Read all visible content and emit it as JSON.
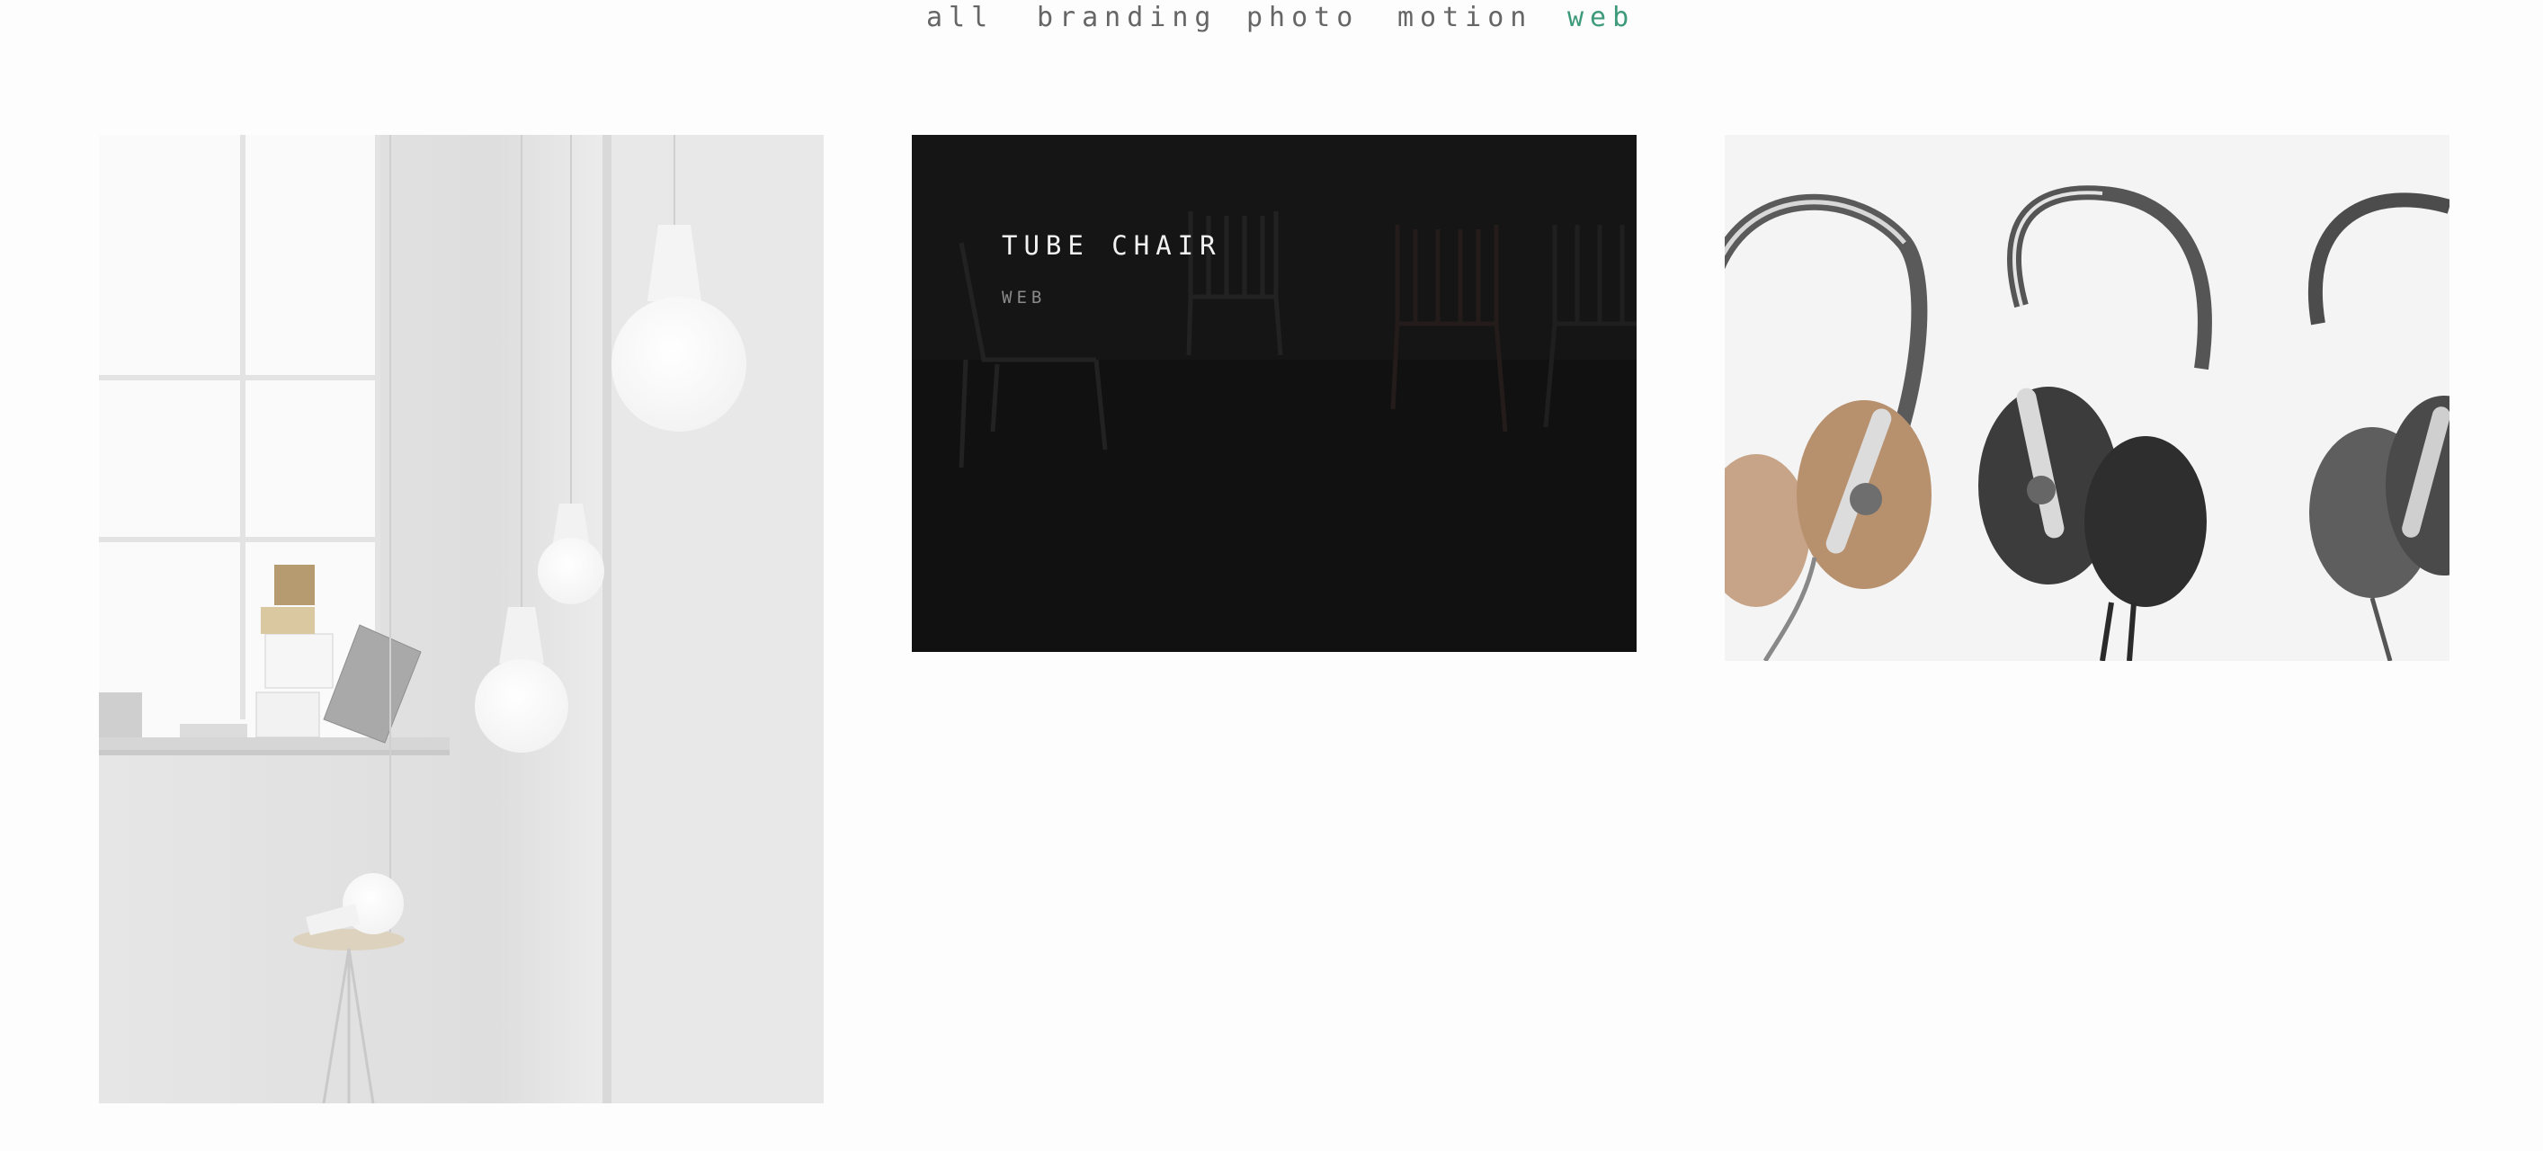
{
  "filters": [
    {
      "label": "all",
      "active": false
    },
    {
      "label": "branding",
      "active": false
    },
    {
      "label": "photo",
      "active": false
    },
    {
      "label": "motion",
      "active": false
    },
    {
      "label": "web",
      "active": true
    }
  ],
  "colors": {
    "accent": "#3d9a7a",
    "nav_text": "#666666",
    "overlay_bg": "#141414",
    "page_bg": "#fdfdfd"
  },
  "portfolio": {
    "items": [
      {
        "image": "pendant-lamps-photo"
      },
      {
        "image": "tube-chair-photo",
        "title": "TUBE CHAIR",
        "category": "WEB",
        "hovered": true
      },
      {
        "image": "headphones-photo"
      }
    ]
  }
}
